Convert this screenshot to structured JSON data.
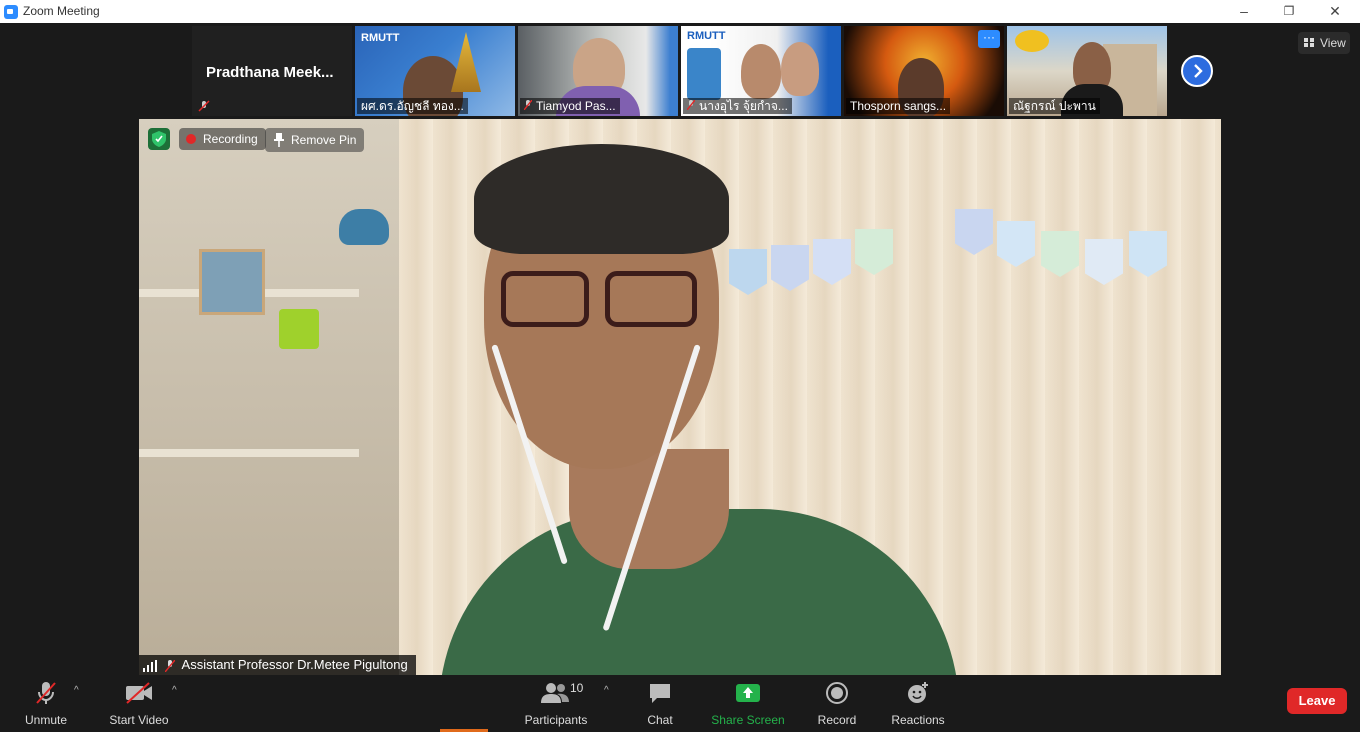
{
  "window": {
    "title": "Zoom Meeting",
    "controls": [
      "–",
      "❐",
      "✕"
    ]
  },
  "active_speaker": {
    "name": "Pradthana  Meek..."
  },
  "thumbnails": [
    {
      "name": "ผศ.ดร.อัญชลี ทอง...",
      "muted": false,
      "brand": "RMUTT"
    },
    {
      "name": "Tiamyod Pas...",
      "muted": true
    },
    {
      "name": "นางอุไร จุ้ยกำจ...",
      "muted": true,
      "brand": "RMUTT"
    },
    {
      "name": "Thosporn sangs...",
      "muted": false,
      "more_label": "···"
    },
    {
      "name": "ณัฐกรณ์ ปะพาน",
      "muted": false
    }
  ],
  "view_button": {
    "label": "View"
  },
  "main_video": {
    "recording_label": "Recording",
    "remove_pin_label": "Remove Pin",
    "participant_name": "Assistant Professor Dr.Metee Pigultong"
  },
  "toolbar": {
    "unmute_label": "Unmute",
    "start_video_label": "Start Video",
    "participants_label": "Participants",
    "participants_count": "10",
    "chat_label": "Chat",
    "share_screen_label": "Share Screen",
    "record_label": "Record",
    "reactions_label": "Reactions",
    "leave_label": "Leave"
  },
  "colors": {
    "accent_blue": "#2d8cff",
    "share_green": "#24b24b",
    "leave_red": "#e02828",
    "recording_red": "#e02828"
  }
}
